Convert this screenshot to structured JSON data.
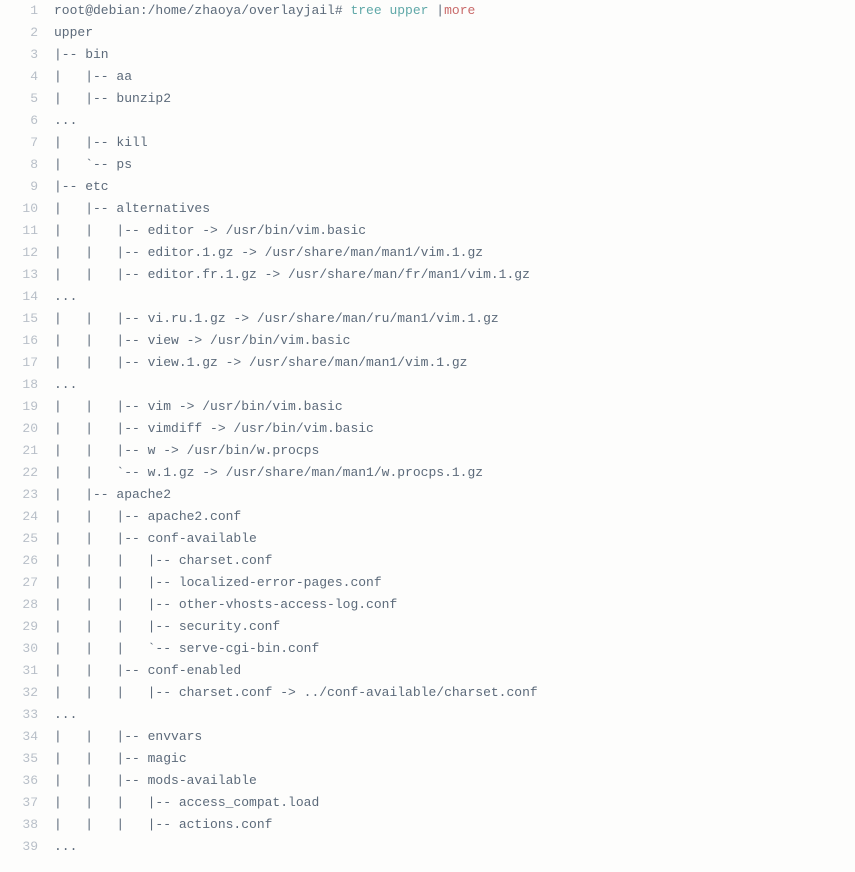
{
  "lines": [
    {
      "num": 1,
      "segs": [
        {
          "t": "root@debian:/home/zhaoya/overlayjail# "
        },
        {
          "t": "tree upper ",
          "cls": "cyan"
        },
        {
          "t": "|"
        },
        {
          "t": "more",
          "cls": "pipe-more"
        }
      ]
    },
    {
      "num": 2,
      "segs": [
        {
          "t": "upper"
        }
      ]
    },
    {
      "num": 3,
      "segs": [
        {
          "t": "|-- bin"
        }
      ]
    },
    {
      "num": 4,
      "segs": [
        {
          "t": "|   |-- aa"
        }
      ]
    },
    {
      "num": 5,
      "segs": [
        {
          "t": "|   |-- bunzip2"
        }
      ]
    },
    {
      "num": 6,
      "segs": [
        {
          "t": "..."
        }
      ]
    },
    {
      "num": 7,
      "segs": [
        {
          "t": "|   |-- kill"
        }
      ]
    },
    {
      "num": 8,
      "segs": [
        {
          "t": "|   `-- ps"
        }
      ]
    },
    {
      "num": 9,
      "segs": [
        {
          "t": "|-- etc"
        }
      ]
    },
    {
      "num": 10,
      "segs": [
        {
          "t": "|   |-- alternatives"
        }
      ]
    },
    {
      "num": 11,
      "segs": [
        {
          "t": "|   |   |-- editor -> /usr/bin/vim.basic"
        }
      ]
    },
    {
      "num": 12,
      "segs": [
        {
          "t": "|   |   |-- editor.1.gz -> /usr/share/man/man1/vim.1.gz"
        }
      ]
    },
    {
      "num": 13,
      "segs": [
        {
          "t": "|   |   |-- editor.fr.1.gz -> /usr/share/man/fr/man1/vim.1.gz"
        }
      ]
    },
    {
      "num": 14,
      "segs": [
        {
          "t": "..."
        }
      ]
    },
    {
      "num": 15,
      "segs": [
        {
          "t": "|   |   |-- vi.ru.1.gz -> /usr/share/man/ru/man1/vim.1.gz"
        }
      ]
    },
    {
      "num": 16,
      "segs": [
        {
          "t": "|   |   |-- view -> /usr/bin/vim.basic"
        }
      ]
    },
    {
      "num": 17,
      "segs": [
        {
          "t": "|   |   |-- view.1.gz -> /usr/share/man/man1/vim.1.gz"
        }
      ]
    },
    {
      "num": 18,
      "segs": [
        {
          "t": "..."
        }
      ]
    },
    {
      "num": 19,
      "segs": [
        {
          "t": "|   |   |-- vim -> /usr/bin/vim.basic"
        }
      ]
    },
    {
      "num": 20,
      "segs": [
        {
          "t": "|   |   |-- vimdiff -> /usr/bin/vim.basic"
        }
      ]
    },
    {
      "num": 21,
      "segs": [
        {
          "t": "|   |   |-- w -> /usr/bin/w.procps"
        }
      ]
    },
    {
      "num": 22,
      "segs": [
        {
          "t": "|   |   `-- w.1.gz -> /usr/share/man/man1/w.procps.1.gz"
        }
      ]
    },
    {
      "num": 23,
      "segs": [
        {
          "t": "|   |-- apache2"
        }
      ]
    },
    {
      "num": 24,
      "segs": [
        {
          "t": "|   |   |-- apache2.conf"
        }
      ]
    },
    {
      "num": 25,
      "segs": [
        {
          "t": "|   |   |-- conf-available"
        }
      ]
    },
    {
      "num": 26,
      "segs": [
        {
          "t": "|   |   |   |-- charset.conf"
        }
      ]
    },
    {
      "num": 27,
      "segs": [
        {
          "t": "|   |   |   |-- localized-error-pages.conf"
        }
      ]
    },
    {
      "num": 28,
      "segs": [
        {
          "t": "|   |   |   |-- other-vhosts-access-log.conf"
        }
      ]
    },
    {
      "num": 29,
      "segs": [
        {
          "t": "|   |   |   |-- security.conf"
        }
      ]
    },
    {
      "num": 30,
      "segs": [
        {
          "t": "|   |   |   `-- serve-cgi-bin.conf"
        }
      ]
    },
    {
      "num": 31,
      "segs": [
        {
          "t": "|   |   |-- conf-enabled"
        }
      ]
    },
    {
      "num": 32,
      "segs": [
        {
          "t": "|   |   |   |-- charset.conf -> ../conf-available/charset.conf"
        }
      ]
    },
    {
      "num": 33,
      "segs": [
        {
          "t": "..."
        }
      ]
    },
    {
      "num": 34,
      "segs": [
        {
          "t": "|   |   |-- envvars"
        }
      ]
    },
    {
      "num": 35,
      "segs": [
        {
          "t": "|   |   |-- magic"
        }
      ]
    },
    {
      "num": 36,
      "segs": [
        {
          "t": "|   |   |-- mods-available"
        }
      ]
    },
    {
      "num": 37,
      "segs": [
        {
          "t": "|   |   |   |-- access_compat.load"
        }
      ]
    },
    {
      "num": 38,
      "segs": [
        {
          "t": "|   |   |   |-- actions.conf"
        }
      ]
    },
    {
      "num": 39,
      "segs": [
        {
          "t": "..."
        }
      ]
    }
  ]
}
